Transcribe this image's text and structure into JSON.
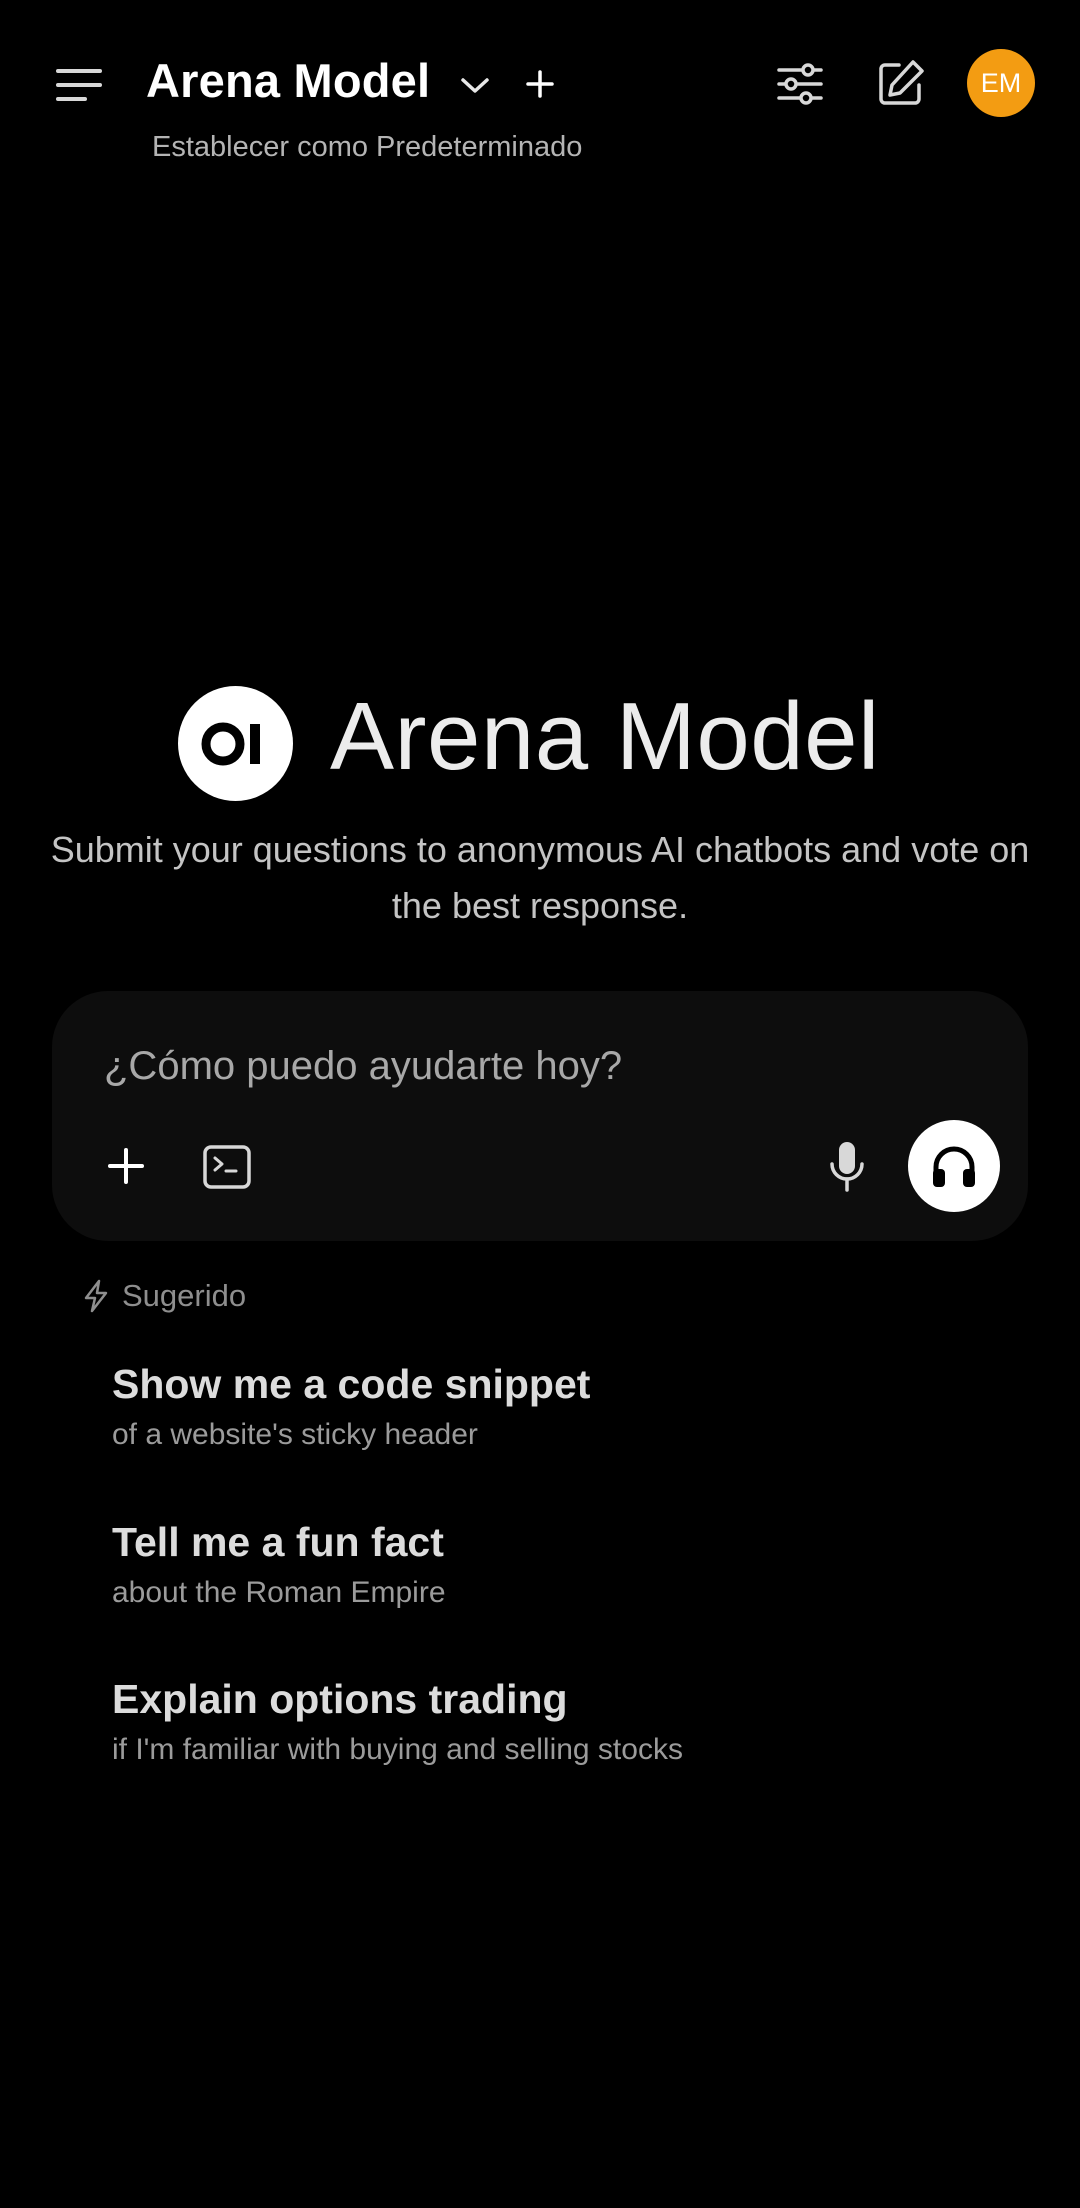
{
  "header": {
    "model_name": "Arena Model",
    "set_default_label": "Establecer como Predeterminado",
    "avatar_initials": "EM",
    "avatar_color": "#f39c12",
    "icons": [
      "menu-icon",
      "chevron-down-icon",
      "plus-icon",
      "sliders-icon",
      "edit-icon"
    ]
  },
  "hero": {
    "title": "Arena Model",
    "description": "Submit your questions to anonymous AI chatbots and vote on the best response.",
    "logo_icon": "openwebui-logo"
  },
  "composer": {
    "placeholder": "¿Cómo puedo ayudarte hoy?",
    "value": "",
    "icons": [
      "plus-icon",
      "terminal-icon",
      "microphone-icon",
      "headphones-icon"
    ]
  },
  "suggestions": {
    "label": "Sugerido",
    "icon": "bolt-icon",
    "items": [
      {
        "title": "Show me a code snippet",
        "subtitle": "of a website's sticky header"
      },
      {
        "title": "Tell me a fun fact",
        "subtitle": "about the Roman Empire"
      },
      {
        "title": "Explain options trading",
        "subtitle": "if I'm familiar with buying and selling stocks"
      }
    ]
  }
}
